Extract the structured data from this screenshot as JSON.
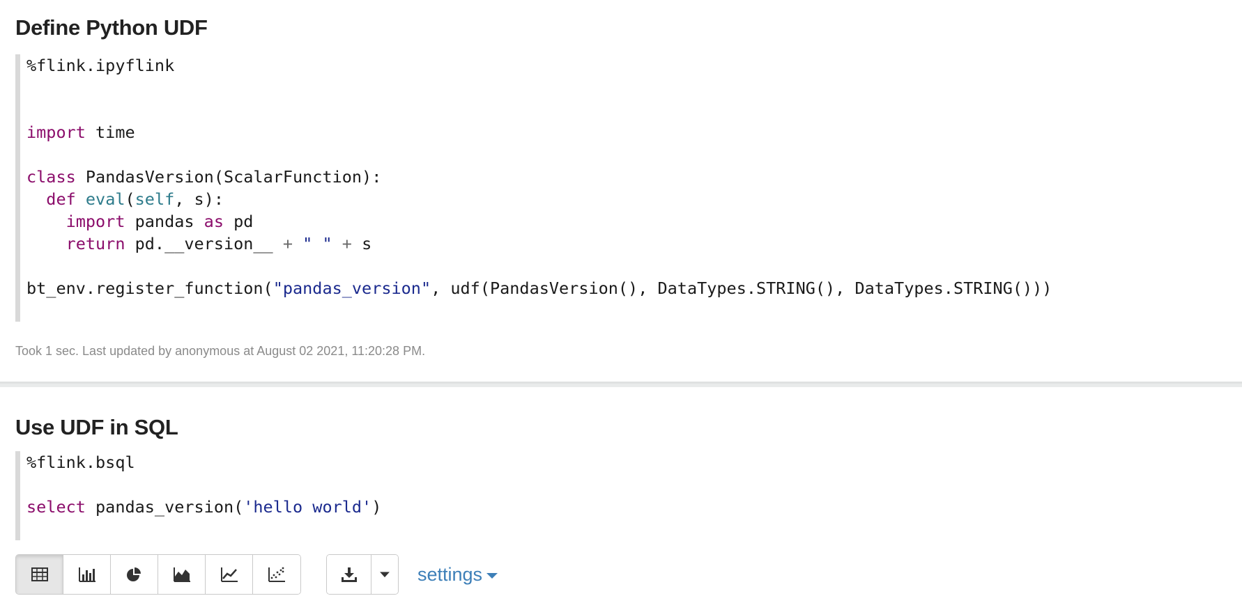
{
  "paragraph1": {
    "title": "Define Python UDF",
    "status": "Took 1 sec. Last updated by anonymous at August 02 2021, 11:20:28 PM."
  },
  "paragraph2": {
    "title": "Use UDF in SQL"
  },
  "toolbar": {
    "buttons": [
      "table-icon",
      "bar-chart-icon",
      "pie-chart-icon",
      "area-chart-icon",
      "line-chart-icon",
      "scatter-chart-icon"
    ],
    "active": "table",
    "settings_label": "settings"
  },
  "colors": {
    "keyword": "#8b0d6b",
    "builtin": "#2d7b8b",
    "string": "#1b2a8e",
    "link": "#3d7fb8"
  }
}
